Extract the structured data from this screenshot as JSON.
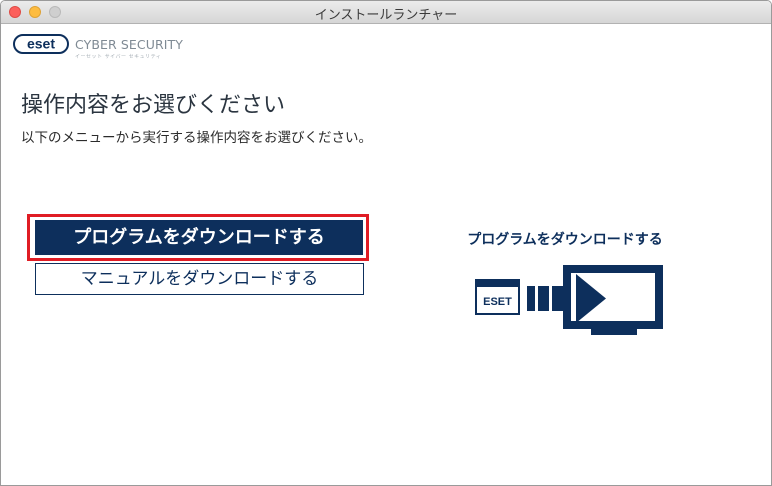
{
  "window": {
    "title": "インストールランチャー"
  },
  "brand": {
    "logo_text": "eset",
    "product_name": "CYBER SECURITY",
    "product_subtitle": "イーセット サイバー セキュリティ"
  },
  "main": {
    "heading": "操作内容をお選びください",
    "instruction": "以下のメニューから実行する操作内容をお選びください。",
    "options": [
      {
        "label": "プログラムをダウンロードする",
        "selected": true
      },
      {
        "label": "マニュアルをダウンロードする",
        "selected": false
      }
    ]
  },
  "preview": {
    "title": "プログラムをダウンロードする",
    "badge_text": "ESET"
  },
  "colors": {
    "primary": "#0d2f5c",
    "highlight": "#e01c24",
    "brand_gray": "#7f8a94"
  }
}
